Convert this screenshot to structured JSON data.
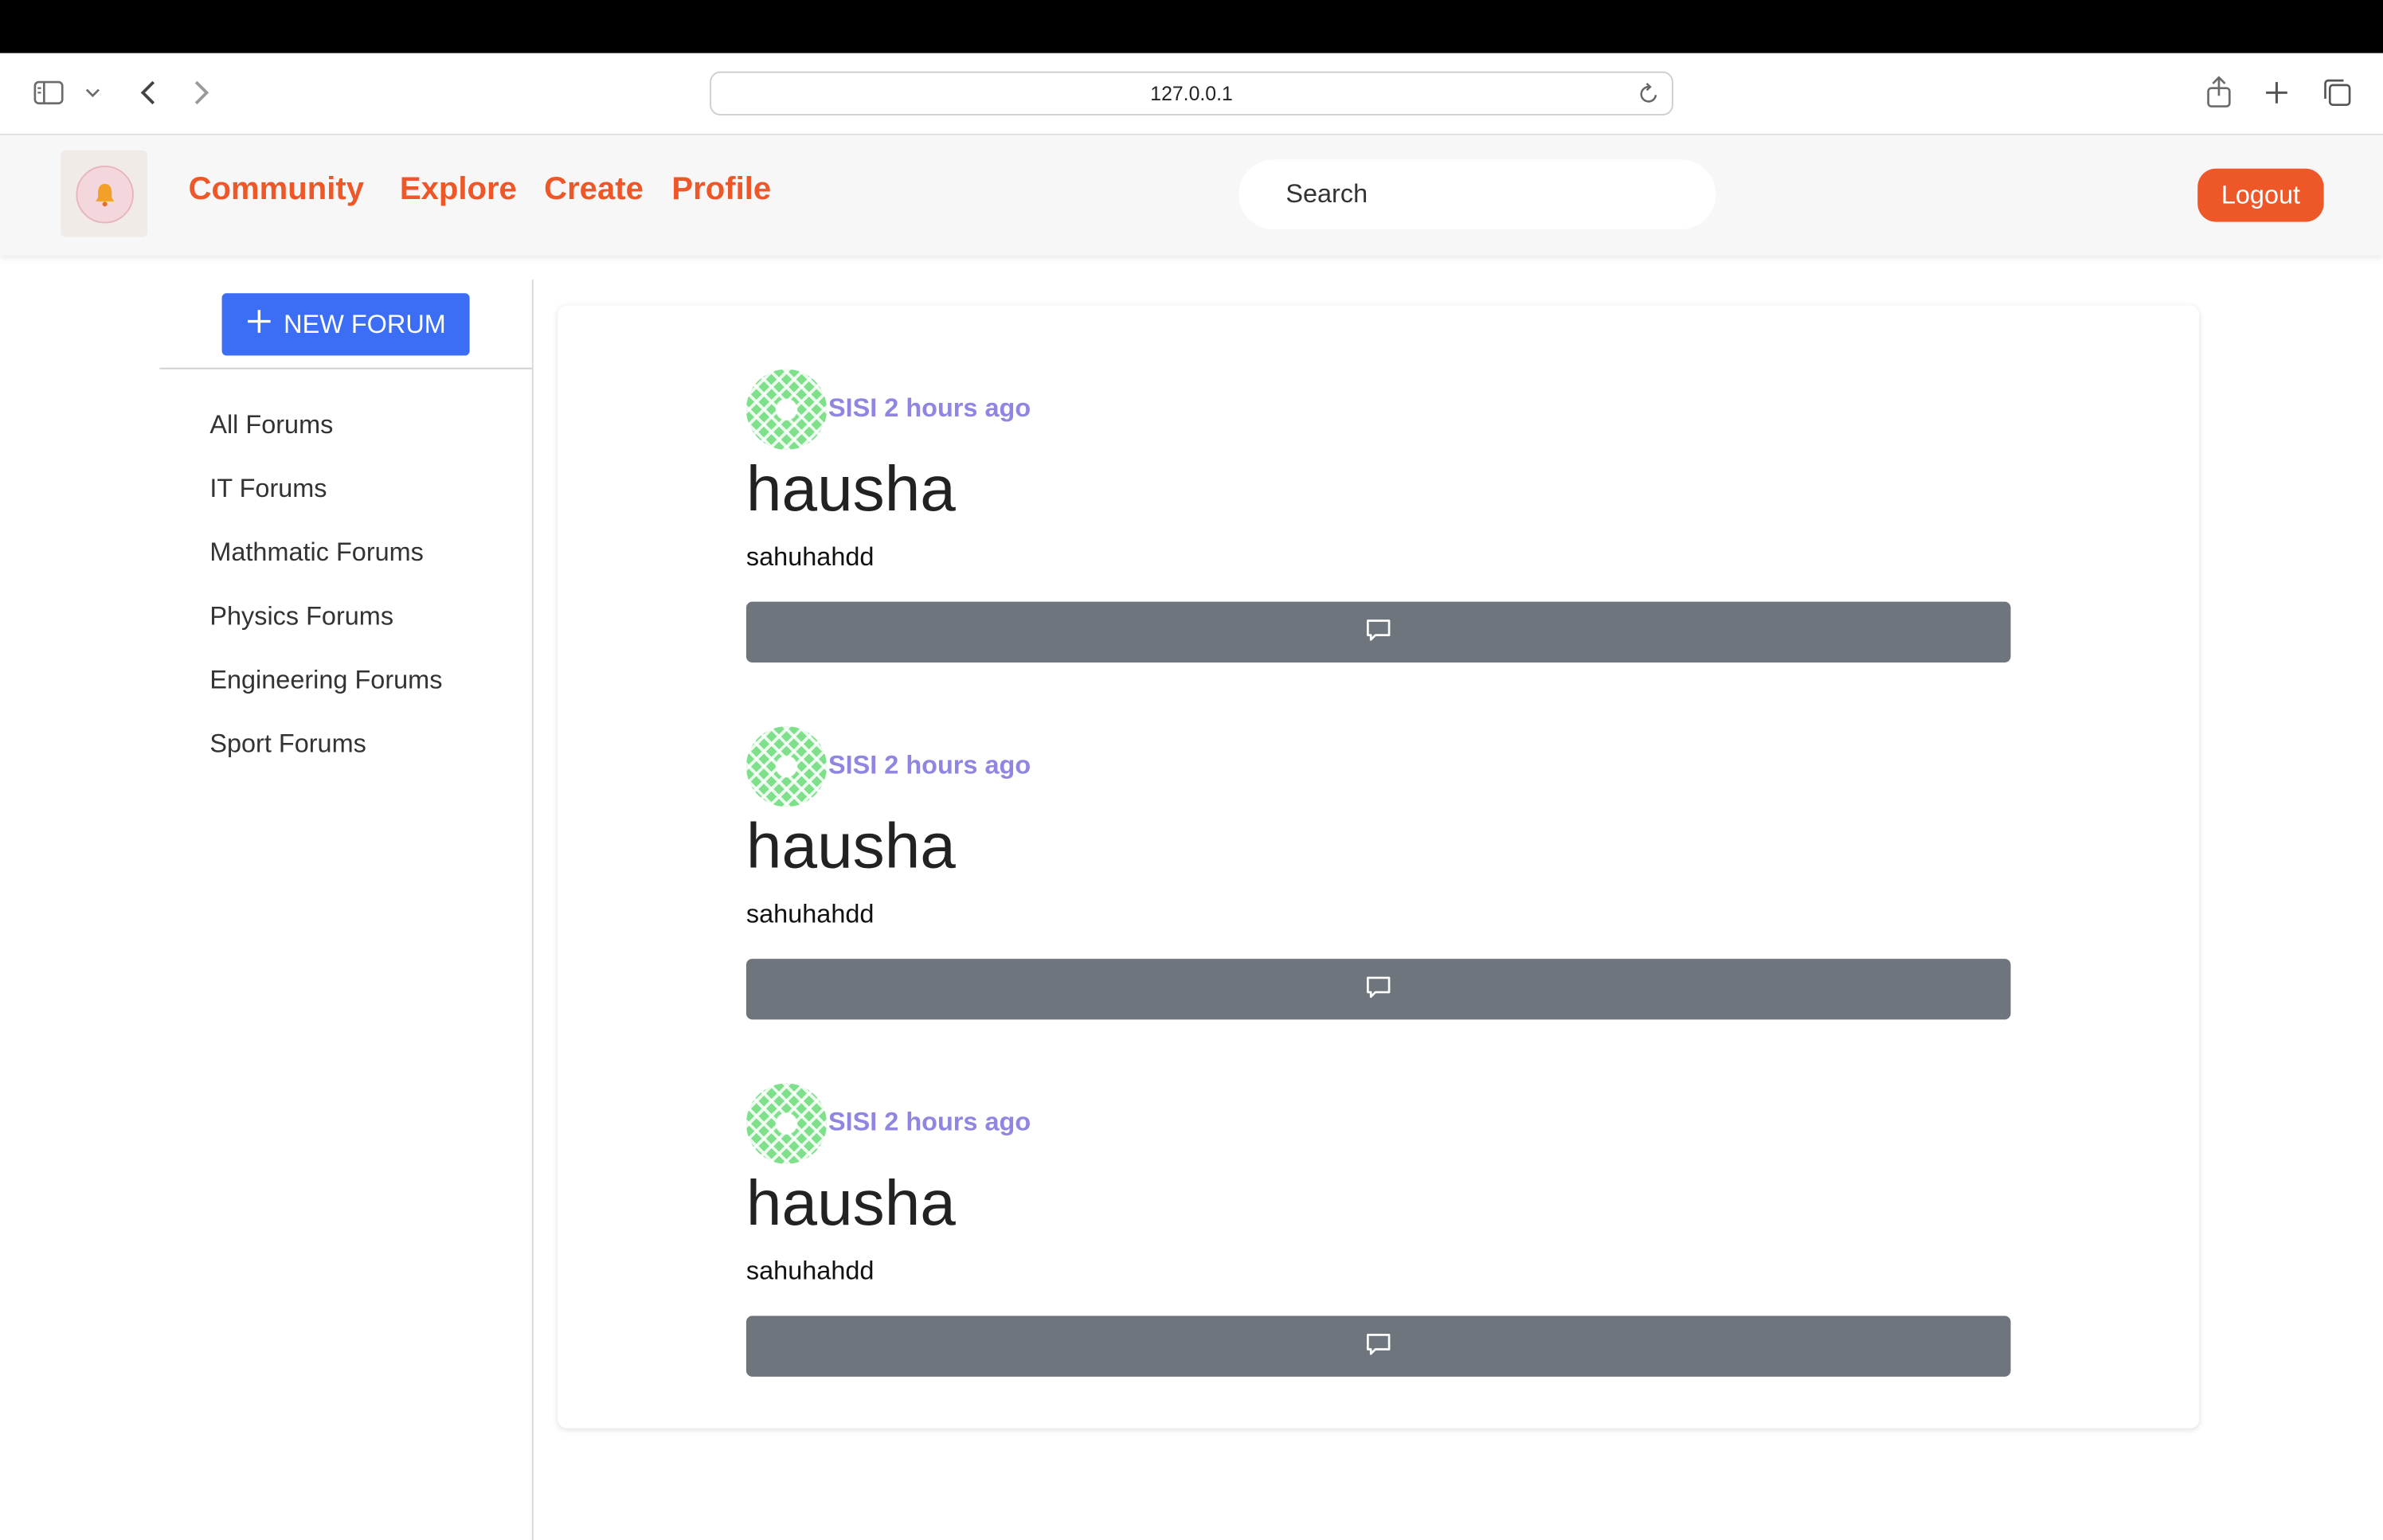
{
  "browser": {
    "url": "127.0.0.1",
    "icons": [
      "sidebar-icon",
      "chevron-down-icon",
      "back-icon",
      "forward-icon",
      "reload-icon",
      "share-icon",
      "new-tab-icon",
      "tabs-overview-icon"
    ]
  },
  "navbar": {
    "logo_icon": "bell-icon",
    "links": [
      "Community",
      "Explore",
      "Create",
      "Profile"
    ],
    "search_placeholder": "Search",
    "logout_label": "Logout",
    "accent_color": "#ee5727"
  },
  "sidebar": {
    "new_forum_label": "NEW FORUM",
    "items": [
      "All Forums",
      "IT Forums",
      "Mathmatic Forums",
      "Physics Forums",
      "Engineering Forums",
      "Sport Forums"
    ]
  },
  "posts": [
    {
      "meta": "SISI 2 hours ago",
      "title": "hausha",
      "body": "sahuhahdd",
      "comment_icon": "comment-icon"
    },
    {
      "meta": "SISI 2 hours ago",
      "title": "hausha",
      "body": "sahuhahdd",
      "comment_icon": "comment-icon"
    },
    {
      "meta": "SISI 2 hours ago",
      "title": "hausha",
      "body": "sahuhahdd",
      "comment_icon": "comment-icon"
    }
  ]
}
